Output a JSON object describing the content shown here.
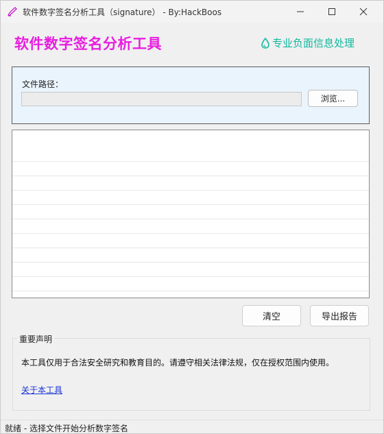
{
  "window": {
    "title": "软件数字签名分析工具（signature） - By:HackBoos"
  },
  "header": {
    "title": "软件数字签名分析工具",
    "tagline": "专业负面信息处理",
    "tagline_icon": "drop-icon",
    "accent_color": "#e81ee0",
    "tagline_color": "#10b9a0"
  },
  "file_panel": {
    "label": "文件路径：",
    "path_value": "",
    "browse_label": "浏览..."
  },
  "results": {
    "items": []
  },
  "actions": {
    "clear_label": "清空",
    "export_label": "导出报告"
  },
  "notice": {
    "title": "重要声明",
    "text": "本工具仅用于合法安全研究和教育目的。请遵守相关法律法规，仅在授权范围内使用。",
    "link_label": "关于本工具"
  },
  "status": {
    "text": "就绪 - 选择文件开始分析数字签名"
  }
}
